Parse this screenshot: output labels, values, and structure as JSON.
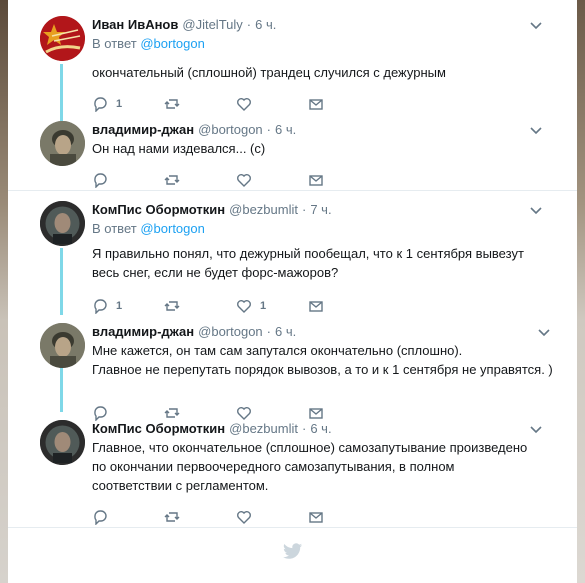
{
  "tweets": [
    {
      "name": "Иван ИвАнов",
      "handle": "@JitelTuly",
      "time": "6 ч.",
      "reply_prefix": "В ответ",
      "reply_handle": "@bortogon",
      "text": "окончательный (сплошной) трандец случился с дежурным",
      "reply_count": "1",
      "retweet_count": "",
      "like_count": ""
    },
    {
      "name": "владимир-джан",
      "handle": "@bortogon",
      "time": "6 ч.",
      "text": "Он над нами издевался... (с)",
      "reply_count": "",
      "retweet_count": "",
      "like_count": ""
    },
    {
      "name": "КомПис Обормоткин",
      "handle": "@bezbumlit",
      "time": "7 ч.",
      "reply_prefix": "В ответ",
      "reply_handle": "@bortogon",
      "text": "Я правильно понял, что дежурный пообещал, что к 1 сентября вывезут весь снег, если не будет форс-мажоров?",
      "reply_count": "1",
      "retweet_count": "",
      "like_count": "1"
    },
    {
      "name": "владимир-джан",
      "handle": "@bortogon",
      "time": "6 ч.",
      "text_line1": "Мне кажется, он там сам запутался окончательно (сплошно).",
      "text_line2": "Главное не перепутать порядок вывозов, а то и к 1 сентября не управятся. )",
      "reply_count": "",
      "retweet_count": "",
      "like_count": ""
    },
    {
      "name": "КомПис Обормоткин",
      "handle": "@bezbumlit",
      "time": "6 ч.",
      "text": "Главное, что окончательное (сплошное) самозапутывание произведено по окончании первоочередного самозапутывания, в полном соответствии с регламентом.",
      "reply_count": "",
      "retweet_count": "",
      "like_count": ""
    }
  ],
  "separator": "·",
  "icons": {
    "reply": "reply-icon",
    "retweet": "retweet-icon",
    "like": "heart-icon",
    "dm": "envelope-icon",
    "more": "chevron-down-icon",
    "footer": "twitter-bird-icon"
  },
  "colors": {
    "link": "#1da1f2",
    "thread_line": "#7fd8e8",
    "muted": "#657786",
    "text": "#14171a",
    "footer_bird": "#ccd6dd"
  }
}
